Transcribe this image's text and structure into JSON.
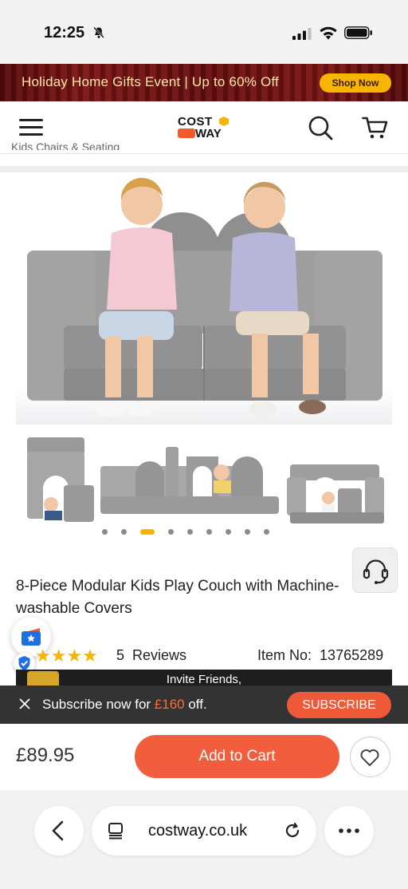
{
  "status_bar": {
    "time": "12:25"
  },
  "promo": {
    "text": "Holiday Home Gifts Event  | Up to 60% Off",
    "button": "Shop Now"
  },
  "header": {
    "logo_top": "COST",
    "logo_bottom": "WAY",
    "breadcrumb_peek": "Kids Chairs & Seating"
  },
  "gallery": {
    "dot_count": 9,
    "active_index": 2
  },
  "product": {
    "title": "8-Piece Modular Kids Play Couch with Machine-washable Covers",
    "stars": "★★★★",
    "reviews_count": "5",
    "reviews_label": "Reviews",
    "item_no_label": "Item No:",
    "item_no": "13765289"
  },
  "invite": {
    "line1": "Invite Friends,"
  },
  "subscribe": {
    "text_before": "Subscribe now for ",
    "amount": "£160",
    "text_after": " off.",
    "button": "SUBSCRIBE"
  },
  "purchase": {
    "price": "£89.95",
    "add_to_cart": "Add to Cart"
  },
  "browser": {
    "url": "costway.co.uk"
  },
  "colors": {
    "accent": "#f25e3d",
    "gold": "#f7b500",
    "banner": "#6a0f0f"
  }
}
